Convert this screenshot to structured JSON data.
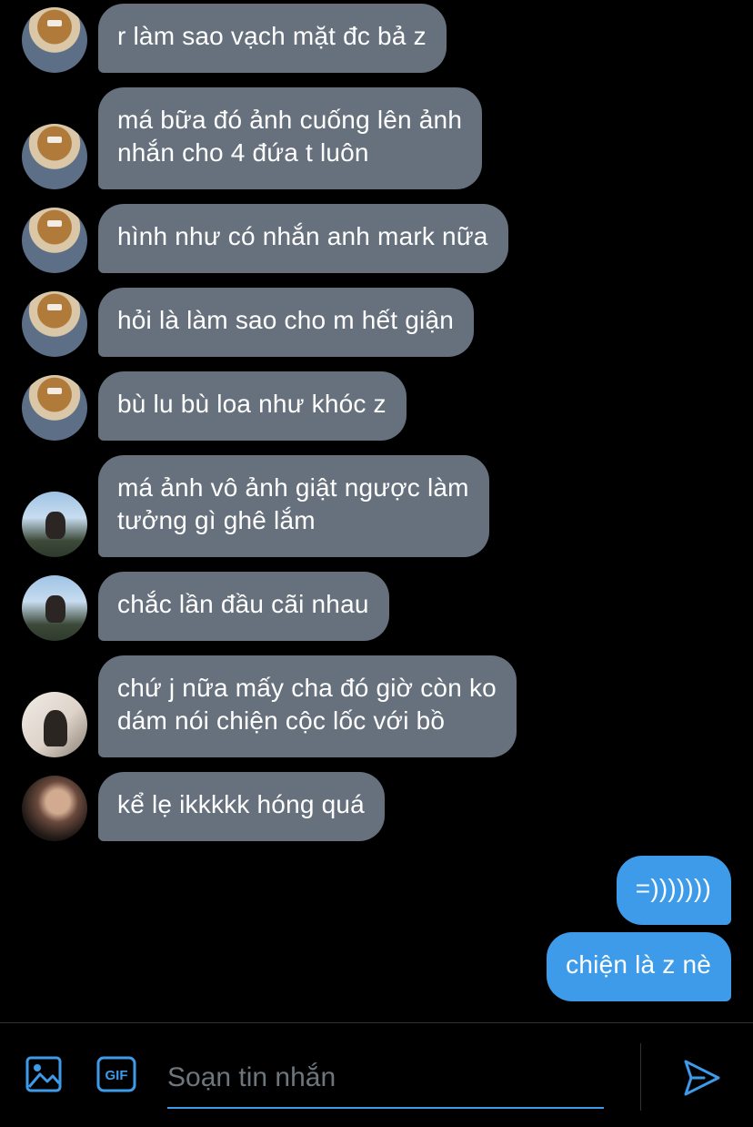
{
  "colors": {
    "background": "#000000",
    "received_bubble": "#66717d",
    "sent_bubble": "#3d9be9",
    "accent": "#3d9be9"
  },
  "messages": [
    {
      "sender": "avatar-a",
      "text": "r làm sao vạch mặt đc bả z"
    },
    {
      "sender": "avatar-a",
      "text": "má bữa đó ảnh cuống lên ảnh\nnhắn cho 4 đứa t luôn"
    },
    {
      "sender": "avatar-a",
      "text": "hình như có nhắn anh mark nữa"
    },
    {
      "sender": "avatar-a",
      "text": "hỏi là làm sao cho m hết giận"
    },
    {
      "sender": "avatar-a",
      "text": "bù lu bù loa như khóc z"
    },
    {
      "sender": "avatar-b",
      "text": "má ảnh vô ảnh giật ngược làm\ntưởng gì ghê lắm"
    },
    {
      "sender": "avatar-b",
      "text": "chắc lần đầu cãi nhau"
    },
    {
      "sender": "avatar-c",
      "text": "chứ j nữa mấy cha đó giờ còn ko\ndám nói chiện cộc lốc với bồ"
    },
    {
      "sender": "avatar-d",
      "text": "kể lẹ ikkkkk hóng quá"
    },
    {
      "sender": "me",
      "text": "=)))))))"
    },
    {
      "sender": "me",
      "text": "chiện là z nè"
    }
  ],
  "composer": {
    "placeholder": "Soạn tin nhắn",
    "icons": [
      "image-icon",
      "gif-icon",
      "send-icon"
    ],
    "gif_label": "GIF"
  }
}
